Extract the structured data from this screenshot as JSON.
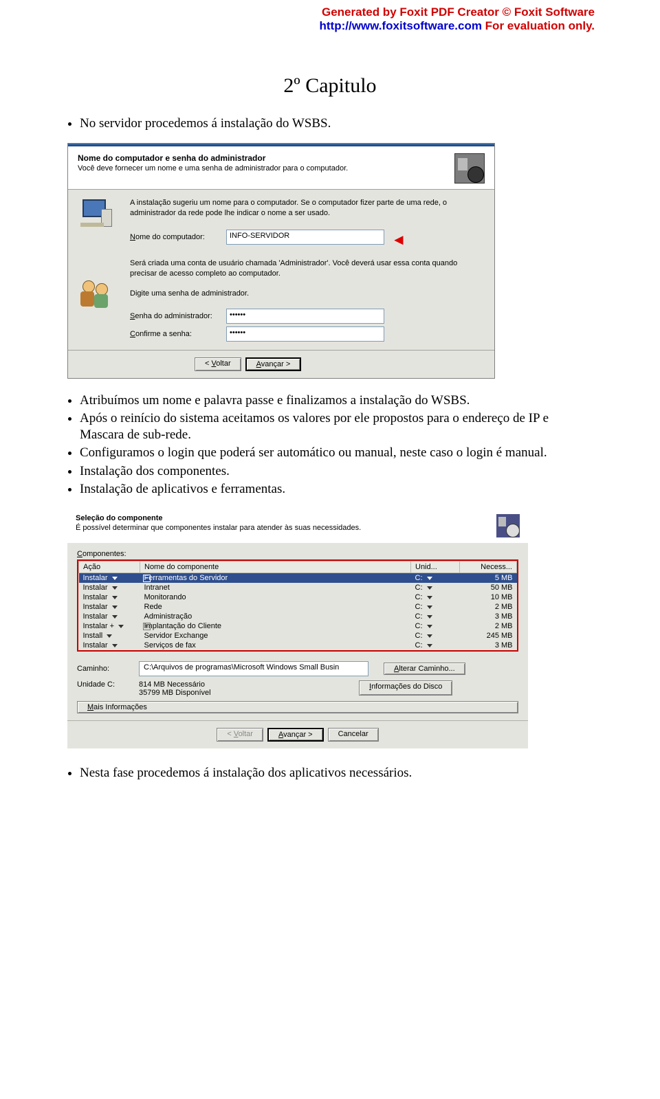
{
  "header": {
    "line1": "Generated by Foxit PDF Creator © Foxit Software",
    "url": "http://www.foxitsoftware.com",
    "tail": "   For evaluation only."
  },
  "chapter_title": "2º Capitulo",
  "intro_bullet": "No servidor procedemos á instalação do WSBS.",
  "dlg1": {
    "head_title": "Nome do computador e senha do administrador",
    "head_sub": "Você deve fornecer um nome e uma senha de administrador para o computador.",
    "p1": "A instalação sugeriu um nome para o computador. Se o computador fizer parte de uma rede, o administrador da rede pode lhe indicar o nome a ser usado.",
    "name_label_pref": "N",
    "name_label_rest": "ome do computador:",
    "name_value": "INFO-SERVIDOR",
    "p2": "Será criada uma conta de usuário chamada 'Administrador'. Você deverá usar essa conta quando precisar de acesso completo ao computador.",
    "p3": "Digite uma senha de administrador.",
    "pw_label_pref": "S",
    "pw_label_rest": "enha do administrador:",
    "pw_value": "••••••",
    "cf_label_pref": "C",
    "cf_label_rest": "onfirme a senha:",
    "cf_value": "••••••",
    "back_pref": "V",
    "back_rest": "oltar",
    "next_pref": "A",
    "next_rest": "vançar >"
  },
  "mid_bullets": [
    "Atribuímos um nome e palavra passe e finalizamos a instalação do WSBS.",
    "Após o reinício do sistema aceitamos os valores por ele propostos para o endereço de IP e Mascara de sub-rede.",
    "Configuramos o login que poderá ser automático ou manual, neste caso o login é manual.",
    "Instalação dos componentes.",
    "Instalação de aplicativos e ferramentas."
  ],
  "dlg2": {
    "head_title": "Seleção do componente",
    "head_sub": "É possível determinar que componentes instalar para atender às suas necessidades.",
    "comp_pref": "C",
    "comp_rest": "omponentes:",
    "th_action": "Ação",
    "th_name": "Nome do componente",
    "th_unit": "Unid...",
    "th_size": "Necess...",
    "rows": [
      {
        "action": "Instalar",
        "pm": "−",
        "name": "Ferramentas do Servidor",
        "unit": "C:",
        "size": "5 MB",
        "sel": true
      },
      {
        "action": "Instalar",
        "pm": "",
        "name": "Intranet",
        "unit": "C:",
        "size": "50 MB"
      },
      {
        "action": "Instalar",
        "pm": "",
        "name": "Monitorando",
        "unit": "C:",
        "size": "10 MB"
      },
      {
        "action": "Instalar",
        "pm": "",
        "name": "Rede",
        "unit": "C:",
        "size": "2 MB"
      },
      {
        "action": "Instalar",
        "pm": "",
        "name": "Administração",
        "unit": "C:",
        "size": "3 MB"
      },
      {
        "action": "Instalar +",
        "pm": "+",
        "name": "Implantação do Cliente",
        "unit": "C:",
        "size": "2 MB"
      },
      {
        "action": "Install",
        "pm": "",
        "name": "Servidor Exchange",
        "unit": "C:",
        "size": "245 MB"
      },
      {
        "action": "Instalar",
        "pm": "",
        "name": "Serviços de fax",
        "unit": "C:",
        "size": "3 MB"
      }
    ],
    "path_label": "Caminho:",
    "path_value": "C:\\Arquivos de programas\\Microsoft Windows Small Busin",
    "chg_path_pref": "A",
    "chg_path_rest": "lterar Caminho...",
    "unit_label": "Unidade C:",
    "need": "814 MB Necessário",
    "avail": "35799 MB Disponível",
    "disk_info_pref": "I",
    "disk_info_rest": "nformações do Disco",
    "more_pref": "M",
    "more_rest": "ais Informações",
    "back_pref": "V",
    "back_rest": "oltar",
    "next_pref": "A",
    "next_rest": "vançar >",
    "cancel": "Cancelar"
  },
  "final_bullet": "Nesta fase procedemos á instalação dos aplicativos necessários."
}
